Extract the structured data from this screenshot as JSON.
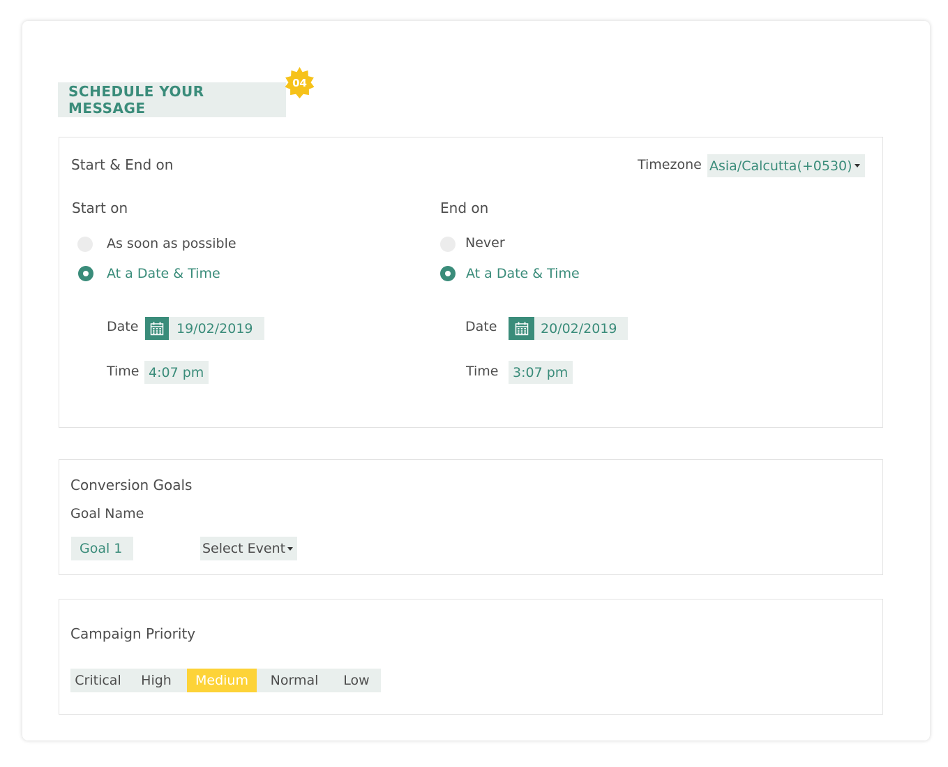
{
  "header": {
    "title": "SCHEDULE YOUR MESSAGE",
    "step_badge": "04"
  },
  "colors": {
    "accent": "#3a8c7a",
    "badge": "#f6c21a",
    "active_priority": "#fdd338",
    "field_bg": "#e9efed"
  },
  "schedule": {
    "section_title": "Start & End on",
    "timezone_label": "Timezone",
    "timezone_value": "Asia/Calcutta(+0530)",
    "start": {
      "heading": "Start on",
      "option_asap": "As soon as possible",
      "option_date": "At a Date & Time",
      "selected": "At a Date & Time",
      "date_label": "Date",
      "date_value": "19/02/2019",
      "time_label": "Time",
      "time_value": "4:07 pm"
    },
    "end": {
      "heading": "End on",
      "option_never": "Never",
      "option_date": "At a Date & Time",
      "selected": "At a Date & Time",
      "date_label": "Date",
      "date_value": "20/02/2019",
      "time_label": "Time",
      "time_value": "3:07 pm"
    }
  },
  "goals": {
    "section_title": "Conversion Goals",
    "goal_name_label": "Goal Name",
    "goal_value": "Goal 1",
    "event_select": "Select Event"
  },
  "priority": {
    "section_title": "Campaign Priority",
    "options": [
      "Critical",
      "High",
      "Medium",
      "Normal",
      "Low"
    ],
    "selected": "Medium"
  }
}
